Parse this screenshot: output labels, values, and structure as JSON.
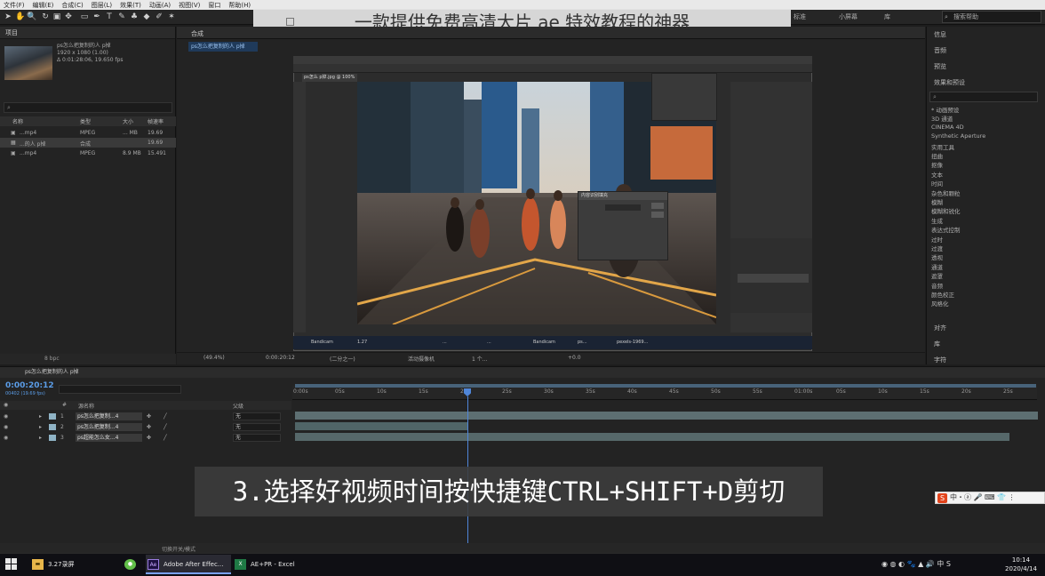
{
  "menubar": {
    "items": [
      "文件(F)",
      "编辑(E)",
      "合成(C)",
      "图层(L)",
      "效果(T)",
      "动画(A)",
      "视图(V)",
      "窗口",
      "帮助(H)"
    ]
  },
  "overlay_title": "一款提供免费高清大片 ae 特效教程的神器",
  "toolbar_right": {
    "workspaces": [
      "标准",
      "小屏幕",
      "库"
    ],
    "search_placeholder": "搜索帮助"
  },
  "project": {
    "title": "项目",
    "thumb_name": "ps怎么把复制的人 p掉",
    "thumb_info1": "1920 x 1080 (1.00)",
    "thumb_info2": "Δ 0:01:28:06, 19.650 fps",
    "columns": [
      "名称",
      "类型",
      "大小",
      "帧速率"
    ],
    "rows": [
      {
        "name": "...mp4",
        "type": "MPEG",
        "size": "... MB",
        "fps": "19.69"
      },
      {
        "name": "...的人 p掉",
        "type": "合成",
        "size": "",
        "fps": "19.69"
      },
      {
        "name": "...mp4",
        "type": "MPEG",
        "size": "8.9 MB",
        "fps": "15.491"
      }
    ],
    "footer_bpc": "8 bpc"
  },
  "composition": {
    "panel_label": "合成",
    "tab_label": "ps怎么把复制的人 p掉",
    "ps_title": "ps怎么把复制的人 p掉",
    "ps_doc_tab": "ps怎么 p掉.jpg @ 100%",
    "dialog_title": "内容识别填充",
    "taskbar_inner": [
      "Bandicam",
      "1.27",
      "...",
      "...",
      "Bandicam",
      "ps...",
      "pexels-1969..."
    ],
    "footer": {
      "zoom": "(49.4%)",
      "timecode": "0:00:20:12",
      "quality": "(二分之一)",
      "view": "活动摄像机",
      "views": "1 个...",
      "offset": "+0.0"
    }
  },
  "right_panel": {
    "items": [
      "信息",
      "音频",
      "预览"
    ],
    "effects_title": "效果和预设",
    "effects": [
      "* 动画预设",
      "3D 通道",
      "CINEMA 4D",
      "Synthetic Aperture",
      "实用工具",
      "扭曲",
      "抠像",
      "文本",
      "时间",
      "杂色和颗粒",
      "模糊",
      "模糊和锐化",
      "生成",
      "表达式控制",
      "过时",
      "过渡",
      "透视",
      "通道",
      "遮罩",
      "音频",
      "颜色校正",
      "风格化"
    ],
    "bottom_items": [
      "对齐",
      "库",
      "字符"
    ]
  },
  "timeline": {
    "tab_label": "ps怎么把复制的人 p掉",
    "timecode": "0:00:20:12",
    "timecode_sub": "00402 (19.69 fps)",
    "col_source": "源名称",
    "col_mode": "父级",
    "layers": [
      {
        "num": "1",
        "name": "ps怎么把复制...4",
        "parent": "无"
      },
      {
        "num": "2",
        "name": "ps怎么把复制...4",
        "parent": "无"
      },
      {
        "num": "3",
        "name": "ps超能怎么女...4",
        "parent": "无"
      }
    ],
    "ticks": [
      "0:00s",
      "05s",
      "10s",
      "15s",
      "20s",
      "25s",
      "30s",
      "35s",
      "40s",
      "45s",
      "50s",
      "55s",
      "01:00s",
      "05s",
      "10s",
      "15s",
      "20s",
      "25s"
    ],
    "footer_label": "切换开关/模式"
  },
  "caption": "3.选择好视频时间按快捷键CTRL+SHIFT+D剪切",
  "ime": "中・ⓐ 🎤 ⌨ 👕 ⋮",
  "taskbar": {
    "items": [
      {
        "label": "3.27录屏",
        "icon": "folder-icon"
      },
      {
        "label": "",
        "icon": "wechat-icon"
      },
      {
        "label": "Adobe After Effec...",
        "icon": "ae-icon"
      },
      {
        "label": "AE+PR - Excel",
        "icon": "excel-icon"
      }
    ],
    "time": "10:14",
    "date": "2020/4/14",
    "tray": "◉ ◍ ◐ 🐾 ▲ 🔊 中 S"
  }
}
